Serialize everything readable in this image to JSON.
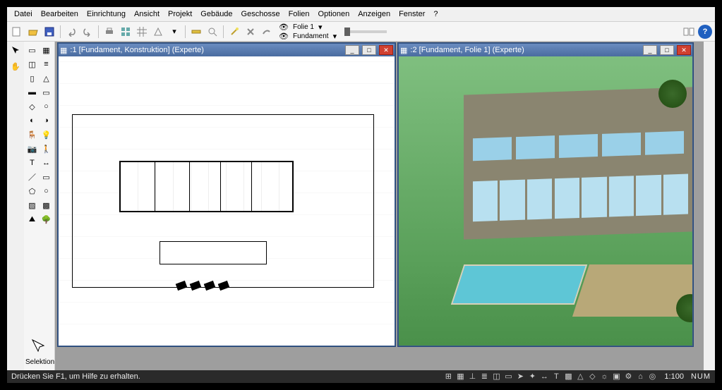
{
  "menu": {
    "datei": "Datei",
    "bearbeiten": "Bearbeiten",
    "einrichtung": "Einrichtung",
    "ansicht": "Ansicht",
    "projekt": "Projekt",
    "gebaeude": "Gebäude",
    "geschosse": "Geschosse",
    "folien": "Folien",
    "optionen": "Optionen",
    "anzeigen": "Anzeigen",
    "fenster": "Fenster",
    "help": "?"
  },
  "toolbar": {
    "layer1_label": "Folie 1",
    "layer2_label": "Fundament",
    "icons": {
      "new": "new-icon",
      "open": "open-icon",
      "save": "save-icon",
      "undo": "undo-icon",
      "redo": "redo-icon",
      "print": "print-icon",
      "views": "views-icon",
      "grid": "grid-icon",
      "measure": "measure-icon",
      "tools": "tools-icon",
      "paint": "paint-icon",
      "wand": "wand-icon",
      "book": "book-icon",
      "help": "help-icon"
    }
  },
  "palette": {
    "selection_label": "Selektion"
  },
  "windows": {
    "plan": {
      "title": ":1 [Fundament, Konstruktion] (Experte)"
    },
    "view3d": {
      "title": ":2 [Fundament, Folie 1] (Experte)"
    },
    "btn_min": "_",
    "btn_max": "□",
    "btn_close": "✕"
  },
  "status": {
    "hint": "Drücken Sie F1, um Hilfe zu erhalten.",
    "scale": "1:100",
    "num": "NUM"
  }
}
